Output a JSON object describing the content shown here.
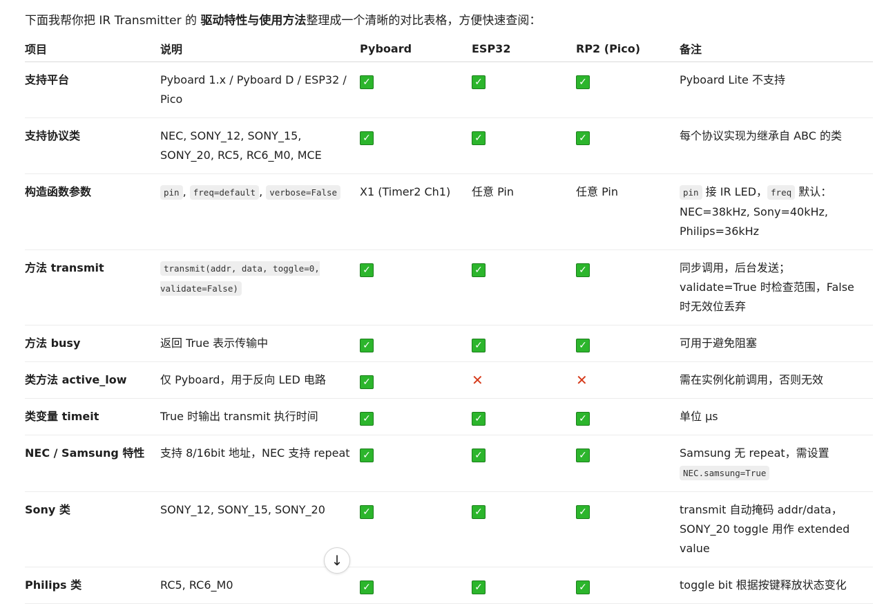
{
  "intro": {
    "prefix": "下面我帮你把 IR Transmitter 的 ",
    "bold": "驱动特性与使用方法",
    "suffix": "整理成一个清晰的对比表格，方便快速查阅："
  },
  "headers": [
    "项目",
    "说明",
    "Pyboard",
    "ESP32",
    "RP2 (Pico)",
    "备注"
  ],
  "icons": {
    "check": "white-check-mark-icon",
    "cross": "cross-mark-icon",
    "scroll": "arrow-down-icon"
  },
  "rows": [
    {
      "item": "支持平台",
      "desc": [
        {
          "t": "Pyboard 1.x / Pyboard D / ESP32 / Pico"
        }
      ],
      "pyboard": {
        "mark": "check"
      },
      "esp32": {
        "mark": "check"
      },
      "rp2": {
        "mark": "check"
      },
      "note": [
        {
          "t": "Pyboard Lite 不支持"
        }
      ]
    },
    {
      "item": "支持协议类",
      "desc": [
        {
          "t": "NEC, SONY_12, SONY_15, SONY_20, RC5, RC6_M0, MCE"
        }
      ],
      "pyboard": {
        "mark": "check"
      },
      "esp32": {
        "mark": "check"
      },
      "rp2": {
        "mark": "check"
      },
      "note": [
        {
          "t": "每个协议实现为继承自 ABC 的类"
        }
      ]
    },
    {
      "item": "构造函数参数",
      "desc": [
        {
          "c": "pin"
        },
        {
          "t": ", "
        },
        {
          "c": "freq=default"
        },
        {
          "t": ", "
        },
        {
          "c": "verbose=False"
        }
      ],
      "pyboard": {
        "text": "X1 (Timer2 Ch1)"
      },
      "esp32": {
        "text": "任意 Pin"
      },
      "rp2": {
        "text": "任意 Pin"
      },
      "note": [
        {
          "c": "pin"
        },
        {
          "t": " 接 IR LED，"
        },
        {
          "c": "freq"
        },
        {
          "t": " 默认：NEC=38kHz, Sony=40kHz, Philips=36kHz"
        }
      ]
    },
    {
      "item": "方法 transmit",
      "desc": [
        {
          "c": "transmit(addr, data, toggle=0, validate=False)"
        }
      ],
      "pyboard": {
        "mark": "check"
      },
      "esp32": {
        "mark": "check"
      },
      "rp2": {
        "mark": "check"
      },
      "note": [
        {
          "t": "同步调用，后台发送；validate=True 时检查范围，False 时无效位丢弃"
        }
      ]
    },
    {
      "item": "方法 busy",
      "desc": [
        {
          "t": "返回 True 表示传输中"
        }
      ],
      "pyboard": {
        "mark": "check"
      },
      "esp32": {
        "mark": "check"
      },
      "rp2": {
        "mark": "check"
      },
      "note": [
        {
          "t": "可用于避免阻塞"
        }
      ]
    },
    {
      "item": "类方法 active_low",
      "desc": [
        {
          "t": "仅 Pyboard，用于反向 LED 电路"
        }
      ],
      "pyboard": {
        "mark": "check"
      },
      "esp32": {
        "mark": "cross"
      },
      "rp2": {
        "mark": "cross"
      },
      "note": [
        {
          "t": "需在实例化前调用，否则无效"
        }
      ]
    },
    {
      "item": "类变量 timeit",
      "desc": [
        {
          "t": "True 时输出 transmit 执行时间"
        }
      ],
      "pyboard": {
        "mark": "check"
      },
      "esp32": {
        "mark": "check"
      },
      "rp2": {
        "mark": "check"
      },
      "note": [
        {
          "t": "单位 μs"
        }
      ]
    },
    {
      "item": "NEC / Samsung 特性",
      "desc": [
        {
          "t": "支持 8/16bit 地址，NEC 支持 repeat"
        }
      ],
      "pyboard": {
        "mark": "check"
      },
      "esp32": {
        "mark": "check"
      },
      "rp2": {
        "mark": "check"
      },
      "note": [
        {
          "t": "Samsung 无 repeat，需设置 "
        },
        {
          "c": "NEC.samsung=True"
        }
      ]
    },
    {
      "item": "Sony 类",
      "desc": [
        {
          "t": "SONY_12, SONY_15, SONY_20"
        }
      ],
      "pyboard": {
        "mark": "check"
      },
      "esp32": {
        "mark": "check"
      },
      "rp2": {
        "mark": "check"
      },
      "note": [
        {
          "t": "transmit 自动掩码 addr/data，SONY_20 toggle 用作 extended value"
        }
      ]
    },
    {
      "item": "Philips 类",
      "desc": [
        {
          "t": "RC5, RC6_M0"
        }
      ],
      "pyboard": {
        "mark": "check"
      },
      "esp32": {
        "mark": "check"
      },
      "rp2": {
        "mark": "check"
      },
      "note": [
        {
          "t": "toggle bit 根据按键释放状态变化"
        }
      ]
    }
  ]
}
